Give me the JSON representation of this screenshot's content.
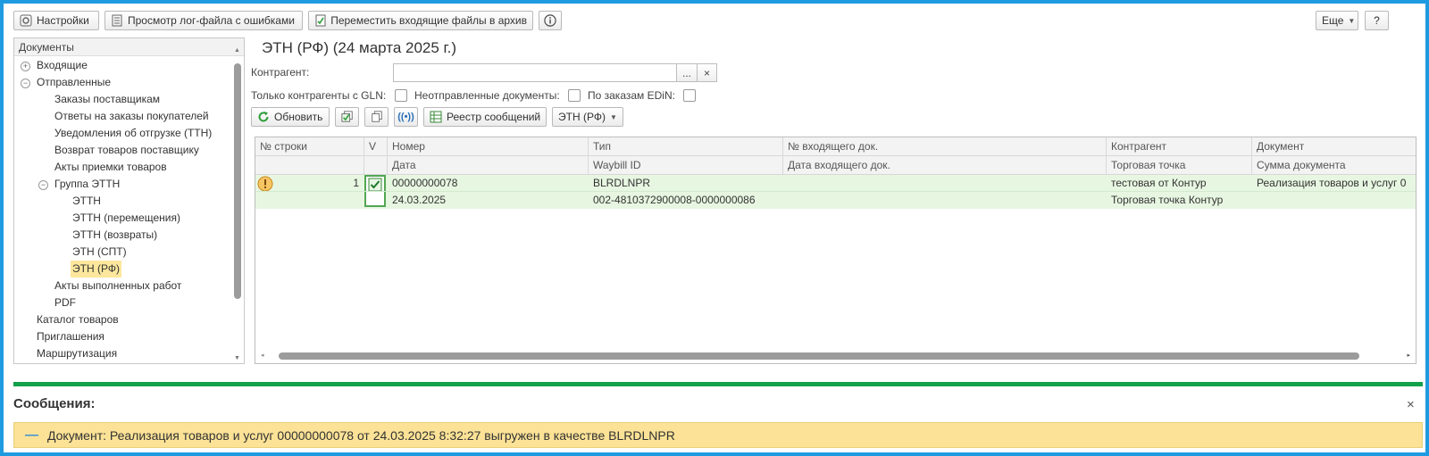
{
  "toolbar": {
    "settings": "Настройки",
    "view_log": "Просмотр лог-файла с ошибками",
    "move_archive": "Переместить входящие файлы в архив",
    "more": "Еще",
    "help": "?"
  },
  "sidebar": {
    "header": "Документы",
    "items": [
      {
        "label": "Входящие"
      },
      {
        "label": "Отправленные"
      },
      {
        "label": "Заказы поставщикам"
      },
      {
        "label": "Ответы на заказы покупателей"
      },
      {
        "label": "Уведомления об отгрузке (ТТН)"
      },
      {
        "label": "Возврат товаров поставщику"
      },
      {
        "label": "Акты приемки товаров"
      },
      {
        "label": "Группа ЭТТН"
      },
      {
        "label": "ЭТТН"
      },
      {
        "label": "ЭТТН (перемещения)"
      },
      {
        "label": "ЭТТН (возвраты)"
      },
      {
        "label": "ЭТН (СПТ)"
      },
      {
        "label": "ЭТН (РФ)"
      },
      {
        "label": "Акты выполненных работ"
      },
      {
        "label": "PDF"
      },
      {
        "label": "Каталог товаров"
      },
      {
        "label": "Приглашения"
      },
      {
        "label": "Маршрутизация"
      }
    ]
  },
  "main": {
    "title": "ЭТН (РФ) (24 марта 2025 г.)",
    "counterparty_label": "Контрагент:",
    "counterparty_value": "",
    "select_btn": "...",
    "clear_btn": "×",
    "filter_gln": "Только контрагенты с GLN:",
    "filter_unsent": "Неотправленные документы:",
    "filter_edin": "По заказам EDiN:",
    "refresh": "Обновить",
    "registry": "Реестр сообщений",
    "doc_type": "ЭТН (РФ)"
  },
  "grid": {
    "headers_row1": [
      "№ строки",
      "V",
      "Номер",
      "Тип",
      "№ входящего док.",
      "Контрагент",
      "Документ"
    ],
    "headers_row2": [
      "Дата",
      "Waybill ID",
      "Дата входящего док.",
      "Торговая точка",
      "Сумма документа"
    ],
    "rows": [
      {
        "line": "1",
        "number": "00000000078",
        "date": "24.03.2025",
        "type": "BLRDLNPR",
        "waybill": "002-4810372900008-0000000086",
        "incoming_no": "",
        "incoming_date": "",
        "counterparty": "тестовая от Контур",
        "point": "Торговая точка Контур",
        "document": "Реализация товаров и услуг 0",
        "sum": ""
      }
    ]
  },
  "messages": {
    "title": "Сообщения:",
    "close": "×",
    "text": "Документ: Реализация товаров и услуг 00000000078 от 24.03.2025 8:32:27 выгружен в качестве BLRDLNPR",
    "dash": "—"
  },
  "colors": {
    "frame": "#1e9be0",
    "row_selected": "#e7f6e1",
    "tree_selected": "#fce79c",
    "divider": "#12a14b",
    "message_bar": "#fbe296"
  }
}
